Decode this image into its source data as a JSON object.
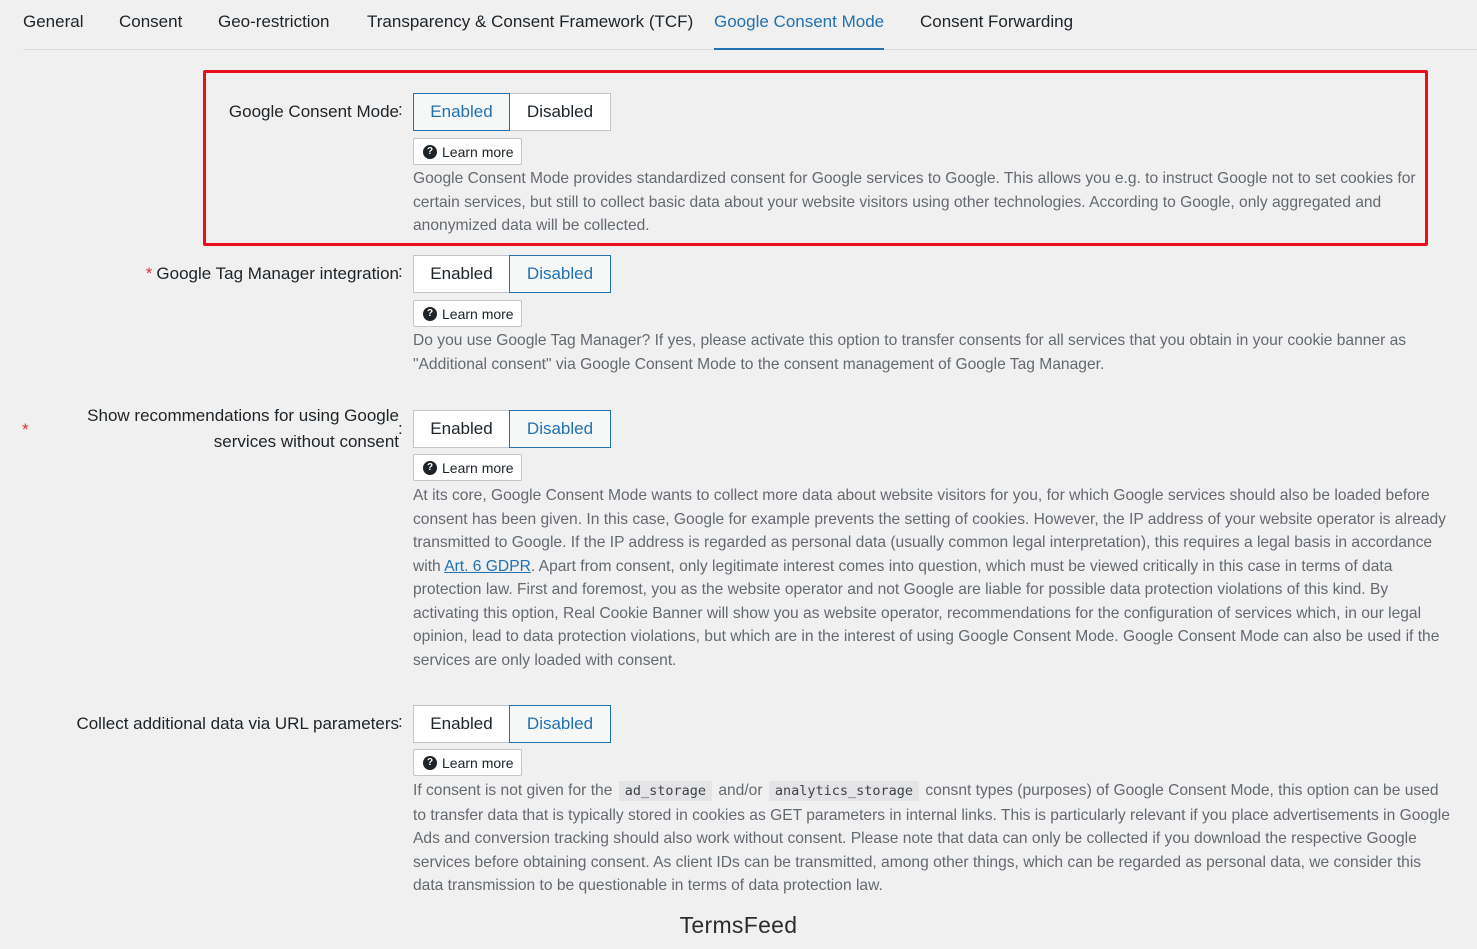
{
  "tabs": [
    {
      "label": "General"
    },
    {
      "label": "Consent"
    },
    {
      "label": "Geo-restriction"
    },
    {
      "label": "Transparency & Consent Framework (TCF)"
    },
    {
      "label": "Google Consent Mode"
    },
    {
      "label": "Consent Forwarding"
    }
  ],
  "active_tab": "Google Consent Mode",
  "settings": [
    {
      "label": "Google Consent Mode",
      "required": false,
      "enabled_label": "Enabled",
      "disabled_label": "Disabled",
      "selected": "Enabled",
      "learn_more": "Learn more",
      "description": "Google Consent Mode provides standardized consent for Google services to Google. This allows you e.g. to instruct Google not to set cookies for certain services, but still to collect basic data about your website visitors using other technologies. According to Google, only aggregated and anonymized data will be collected."
    },
    {
      "label": "Google Tag Manager integration",
      "required": true,
      "enabled_label": "Enabled",
      "disabled_label": "Disabled",
      "selected": "Disabled",
      "learn_more": "Learn more",
      "description": "Do you use Google Tag Manager? If yes, please activate this option to transfer consents for all services that you obtain in your cookie banner as \"Additional consent\" via Google Consent Mode to the consent management of Google Tag Manager."
    },
    {
      "label_line1": "Show recommendations for using Google",
      "label_line2": "services without consent",
      "required": true,
      "enabled_label": "Enabled",
      "disabled_label": "Disabled",
      "selected": "Disabled",
      "learn_more": "Learn more",
      "description_part1": "At its core, Google Consent Mode wants to collect more data about website visitors for you, for which Google services should also be loaded before consent has been given. In this case, Google for example prevents the setting of cookies. However, the IP address of your website operator is already transmitted to Google. If the IP address is regarded as personal data (usually common legal interpretation), this requires a legal basis in accordance with ",
      "description_link": "Art. 6 GDPR",
      "description_part2": ". Apart from consent, only legitimate interest comes into question, which must be viewed critically in this case in terms of data protection law. First and foremost, you as the website operator and not Google are liable for possible data protection violations of this kind. By activating this option, Real Cookie Banner will show you as website operator, recommendations for the configuration of services which, in our legal opinion, lead to data protection violations, but which are in the interest of using Google Consent Mode. Google Consent Mode can also be used if the services are only loaded with consent."
    },
    {
      "label": "Collect additional data via URL parameters",
      "required": false,
      "enabled_label": "Enabled",
      "disabled_label": "Disabled",
      "selected": "Disabled",
      "learn_more": "Learn more",
      "description_part1": "If consent is not given for the ",
      "code1": "ad_storage",
      "description_part2": " and/or ",
      "code2": "analytics_storage",
      "description_part3": " consnt types (purposes) of Google Consent Mode, this option can be used to transfer data that is typically stored in cookies as GET parameters in internal links. This is particularly relevant if you place advertisements in Google Ads and conversion tracking should also work without consent. Please note that data can only be collected if you download the respective Google services before obtaining consent. As client IDs can be transmitted, among other things, which can be regarded as personal data, we consider this data transmission to be questionable in terms of data protection law."
    }
  ],
  "watermark": "TermsFeed",
  "colors": {
    "accent": "#2271b1",
    "highlight_border": "#e8101d",
    "required": "#d63638",
    "background": "#f0f0f1"
  }
}
